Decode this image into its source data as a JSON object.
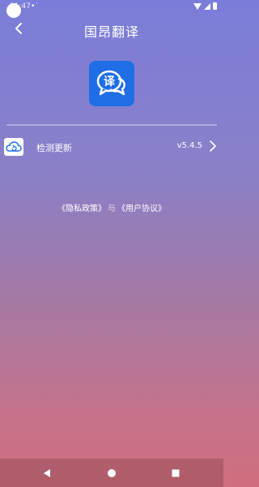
{
  "status_bar": {
    "time": "11:47",
    "sim_indicator": "•˙"
  },
  "header": {
    "title": "国昂翻译",
    "back_icon": "chevron-left-icon"
  },
  "app_logo": {
    "glyph": "译",
    "icon": "speech-bubble-translate-icon",
    "color": "#1f6ee6"
  },
  "update_row": {
    "label": "检测更新",
    "version": "v5.4.5",
    "icon": "cloud-refresh-icon"
  },
  "policy": {
    "privacy": "《隐私政策》",
    "separator": "与",
    "agreement": "《用户协议》"
  },
  "navbar": {
    "back": "triangle-back-icon",
    "home": "circle-home-icon",
    "recents": "square-recents-icon"
  }
}
